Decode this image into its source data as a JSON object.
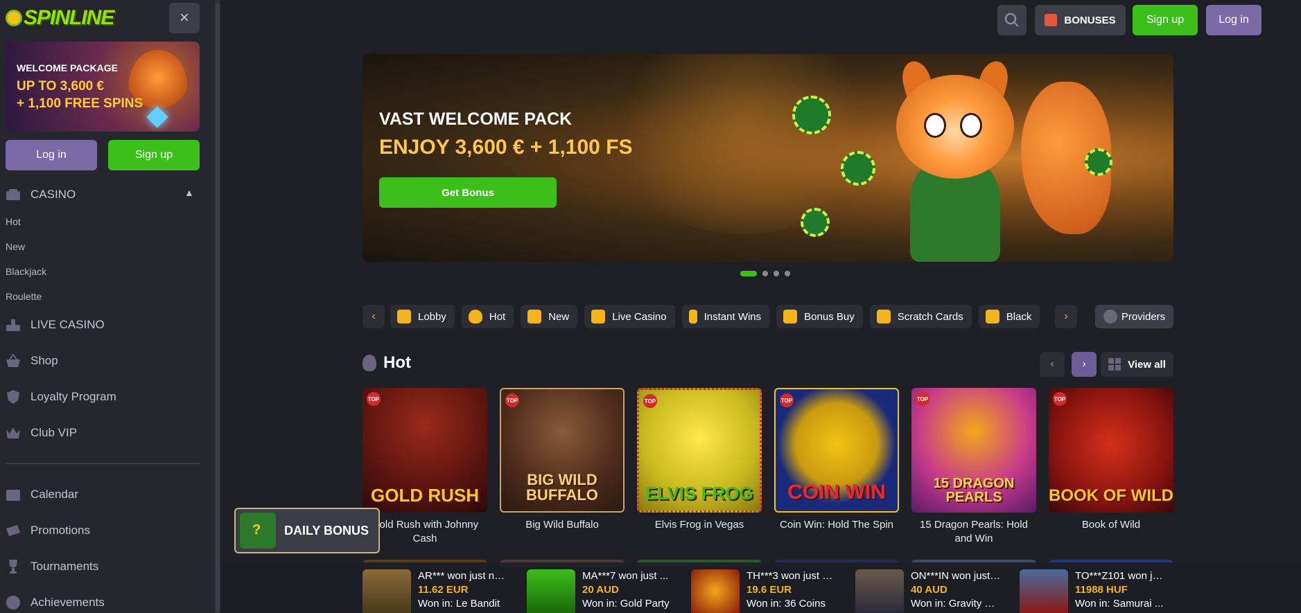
{
  "sidebar": {
    "logo": "SPINLINE",
    "close_icon": "×",
    "promo": {
      "small": "WELCOME PACKAGE",
      "line1": "UP TO 3,600 €",
      "line2": "+ 1,100 FREE SPINS"
    },
    "login_label": "Log in",
    "signup_label": "Sign up",
    "casino_label": "CASINO",
    "casino_sub": [
      "Hot",
      "New",
      "Blackjack",
      "Roulette"
    ],
    "items": [
      {
        "label": "LIVE CASINO",
        "icon": "live-casino-icon"
      },
      {
        "label": "Shop",
        "icon": "shop-basket-icon"
      },
      {
        "label": "Loyalty Program",
        "icon": "shield-icon"
      },
      {
        "label": "Club VIP",
        "icon": "crown-icon"
      }
    ],
    "items2": [
      {
        "label": "Calendar",
        "icon": "calendar-icon"
      },
      {
        "label": "Promotions",
        "icon": "ticket-icon"
      },
      {
        "label": "Tournaments",
        "icon": "trophy-icon"
      },
      {
        "label": "Achievements",
        "icon": "medal-icon"
      }
    ]
  },
  "header": {
    "bonuses_label": "BONUSES",
    "signup_label": "Sign up",
    "login_label": "Log in"
  },
  "hero": {
    "line1": "VAST WELCOME PACK",
    "line2": "ENJOY 3,600 € + 1,100 FS",
    "button": "Get Bonus",
    "slides": 4,
    "active_slide": 1
  },
  "categories": [
    "Lobby",
    "Hot",
    "New",
    "Live Casino",
    "Instant Wins",
    "Bonus Buy",
    "Scratch Cards",
    "Black"
  ],
  "providers_label": "Providers",
  "hot": {
    "title": "Hot",
    "view_all": "View all",
    "badge": "TOP",
    "games": [
      {
        "name": "Gold Rush with Johnny Cash",
        "art": "GOLD RUSH"
      },
      {
        "name": "Big Wild Buffalo",
        "art": "BIG WILD BUFFALO"
      },
      {
        "name": "Elvis Frog in Vegas",
        "art": "ELVIS FROG"
      },
      {
        "name": "Coin Win: Hold The Spin",
        "art": "COIN WIN"
      },
      {
        "name": "15 Dragon Pearls: Hold and Win",
        "art": "15 DRAGON PEARLS"
      },
      {
        "name": "Book of Wild",
        "art": "BOOK OF WILD"
      }
    ]
  },
  "daily_bonus": "DAILY BONUS",
  "winners": [
    {
      "who": "AR*** won just no...",
      "amount": "11.62 EUR",
      "where": "Won in: Le Bandit"
    },
    {
      "who": "MA***7 won just ...",
      "amount": "20 AUD",
      "where": "Won in: Gold Party"
    },
    {
      "who": "TH***3 won just n...",
      "amount": "19.6 EUR",
      "where": "Won in: 36 Coins"
    },
    {
      "who": "ON***IN won just ...",
      "amount": "40 AUD",
      "where": "Won in: Gravity Bl..."
    },
    {
      "who": "TO***Z101 won jus...",
      "amount": "11988 HUF",
      "where": "Won in: Samurai ..."
    }
  ]
}
